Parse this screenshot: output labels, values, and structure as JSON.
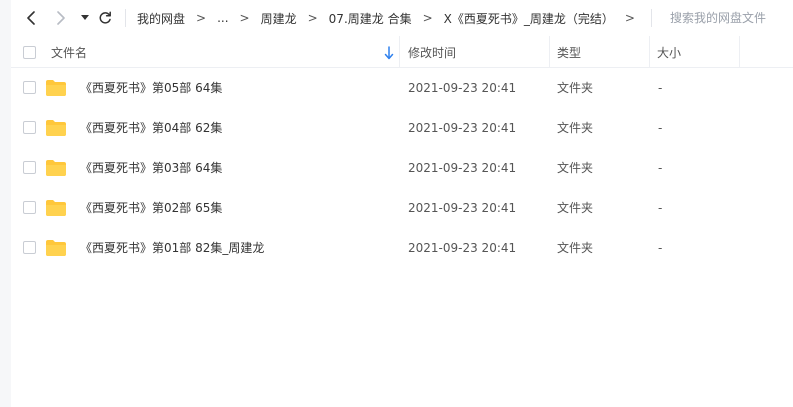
{
  "toolbar": {
    "back_icon": "chevron-left-icon",
    "forward_icon": "chevron-right-icon",
    "history_icon": "caret-down-icon",
    "refresh_icon": "refresh-icon"
  },
  "breadcrumb": {
    "items": [
      "我的网盘",
      "...",
      "周建龙",
      "07.周建龙 合集",
      "X《西夏死书》_周建龙（完结）"
    ],
    "separator": ">",
    "trailing_separator": ">"
  },
  "search": {
    "placeholder": "搜索我的网盘文件"
  },
  "table": {
    "columns": {
      "name": "文件名",
      "mtime": "修改时间",
      "type": "类型",
      "size": "大小"
    },
    "sort_indicator": "down-arrow-icon",
    "rows": [
      {
        "name": "《西夏死书》第05部 64集",
        "mtime": "2021-09-23 20:41",
        "type": "文件夹",
        "size": "-"
      },
      {
        "name": "《西夏死书》第04部 62集",
        "mtime": "2021-09-23 20:41",
        "type": "文件夹",
        "size": "-"
      },
      {
        "name": "《西夏死书》第03部 64集",
        "mtime": "2021-09-23 20:41",
        "type": "文件夹",
        "size": "-"
      },
      {
        "name": "《西夏死书》第02部 65集",
        "mtime": "2021-09-23 20:41",
        "type": "文件夹",
        "size": "-"
      },
      {
        "name": "《西夏死书》第01部 82集_周建龙",
        "mtime": "2021-09-23 20:41",
        "type": "文件夹",
        "size": "-"
      }
    ]
  },
  "colors": {
    "folder": "#FFC73B",
    "sort_arrow": "#2F80ED",
    "border": "#EDEFF3"
  }
}
